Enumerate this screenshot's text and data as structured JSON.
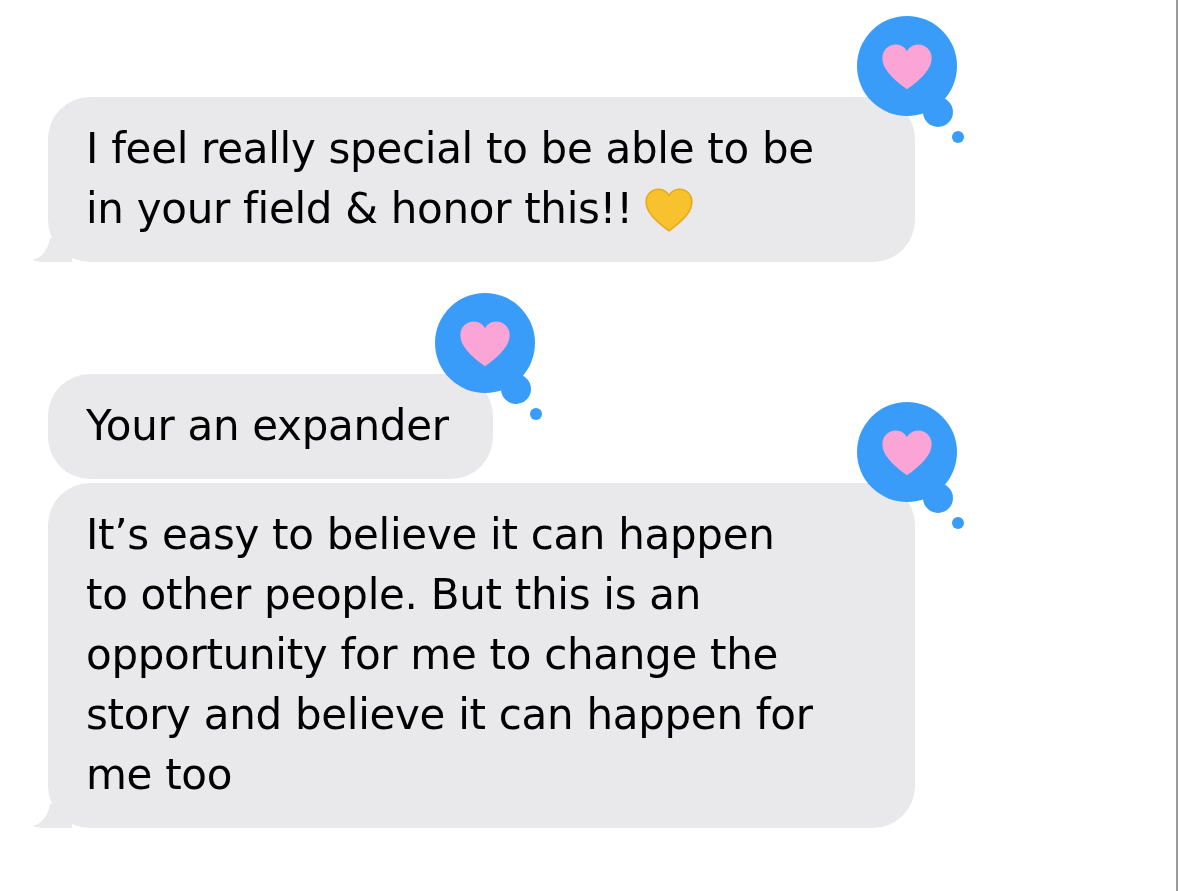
{
  "groups": [
    {
      "messages": [
        {
          "text": "I feel really special to be able to be\nin your field & honor this!!",
          "heart_emoji": true,
          "reacted": true,
          "tail": true
        }
      ]
    },
    {
      "messages": [
        {
          "text": "Your an expander",
          "heart_emoji": false,
          "reacted": true,
          "tail": false
        },
        {
          "text": "It’s easy to believe it can happen\nto other people. But this is an\nopportunity for me to change the\nstory and believe it can happen for\nme too",
          "heart_emoji": false,
          "reacted": true,
          "tail": true
        }
      ]
    }
  ]
}
